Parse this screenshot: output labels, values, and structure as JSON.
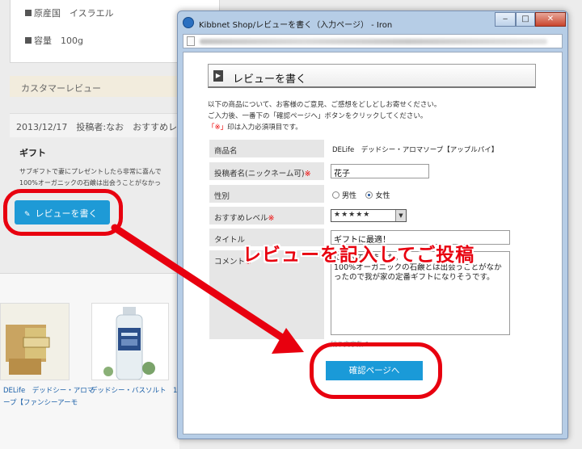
{
  "background_page": {
    "specs": [
      {
        "label": "原産国",
        "value": "イスラエル"
      },
      {
        "label": "容量",
        "value": "100g"
      }
    ],
    "review_section_title": "カスタマーレビュー",
    "review_meta": "2013/12/17　投稿者:なお　おすすめレ",
    "review_title": "ギフト",
    "review_body_lines": [
      "サブギフトで妻にプレゼントしたら非常に喜んで",
      "100%オーガニックの石鹸は出会うことがなかっ"
    ],
    "write_review_button": "レビューを書く",
    "products": [
      {
        "name_line1": "DELife　デッドシー・アロマ",
        "name_line2": "ープ【ファンシーアーモ"
      },
      {
        "name_line1": "デッドシー・バスソルト　1k",
        "name_line2": ""
      }
    ]
  },
  "popup": {
    "title": "Kibbnet Shop/レビューを書く（入力ページ） - Iron",
    "window_buttons": {
      "minimize": "‒",
      "maximize": "□",
      "close": "✕"
    },
    "heading": "レビューを書く",
    "intro_lines": [
      "以下の商品について、お客様のご意見、ご感想をどしどしお寄せください。",
      "ご入力後、一番下の「確認ページへ」ボタンをクリックしてください。"
    ],
    "required_note": {
      "mark": "「※」",
      "text": "印は入力必須項目です。"
    },
    "form": {
      "product_label": "商品名",
      "product_value": "DELife　デッドシー・アロマソープ【アップルパイ】",
      "nickname_label": "投稿者名(ニックネーム可)",
      "nickname_value": "花子",
      "gender_label": "性別",
      "gender_options": [
        "男性",
        "女性"
      ],
      "gender_selected": "女性",
      "rating_label": "おすすめレベル",
      "rating_value": "★★★★★",
      "title_label": "タイトル",
      "title_value": "ギフトに最適！",
      "comment_label": "コメント",
      "comment_value": "に喜んでいました。\n100%オーガニックの石鹸とは出会うことがなかったので我が家の定番ギフトになりそうです。",
      "char_count": "残り文字数:1",
      "required_mark": "※"
    },
    "confirm_button": "確認ページへ"
  },
  "annotation": {
    "callout": "レビューを記入してご投稿",
    "color": "#e8000f"
  }
}
